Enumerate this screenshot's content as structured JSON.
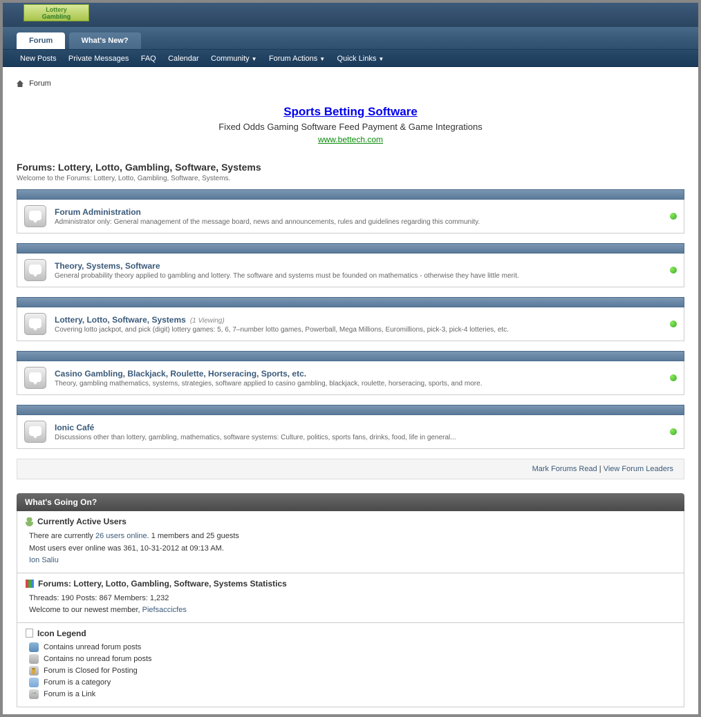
{
  "logo": {
    "line1": "Lottery",
    "line2": "Gambling"
  },
  "tabs": [
    {
      "label": "Forum",
      "active": true
    },
    {
      "label": "What's New?",
      "active": false
    }
  ],
  "subnav": [
    {
      "label": "New Posts",
      "dropdown": false
    },
    {
      "label": "Private Messages",
      "dropdown": false
    },
    {
      "label": "FAQ",
      "dropdown": false
    },
    {
      "label": "Calendar",
      "dropdown": false
    },
    {
      "label": "Community",
      "dropdown": true
    },
    {
      "label": "Forum Actions",
      "dropdown": true
    },
    {
      "label": "Quick Links",
      "dropdown": true
    }
  ],
  "breadcrumb": "Forum",
  "ad": {
    "title": "Sports Betting Software",
    "desc": "Fixed Odds Gaming Software Feed Payment & Game Integrations",
    "url": "www.bettech.com"
  },
  "page": {
    "title": "Forums: Lottery, Lotto, Gambling, Software, Systems",
    "welcome": "Welcome to the Forums: Lottery, Lotto, Gambling, Software, Systems."
  },
  "forums": [
    {
      "title": "Forum Administration",
      "viewing": "",
      "desc": "Administrator only: General management of the message board, news and announcements, rules and guidelines regarding this community."
    },
    {
      "title": "Theory, Systems, Software",
      "viewing": "",
      "desc": "General probability theory applied to gambling and lottery. The software and systems must be founded on mathematics - otherwise they have little merit."
    },
    {
      "title": "Lottery, Lotto, Software, Systems",
      "viewing": "(1 Viewing)",
      "desc": "Covering lotto jackpot, and pick (digit) lottery games: 5, 6, 7–number lotto games, Powerball, Mega Millions, Euromillions, pick-3, pick-4 lotteries, etc."
    },
    {
      "title": "Casino Gambling, Blackjack, Roulette, Horseracing, Sports, etc.",
      "viewing": "",
      "desc": "Theory, gambling mathematics, systems, strategies, software applied to casino gambling, blackjack, roulette, horseracing, sports, and more."
    },
    {
      "title": "Ionic Café",
      "viewing": "",
      "desc": "Discussions other than lottery, gambling, mathematics, software systems: Culture, politics, sports fans, drinks, food, life in general..."
    }
  ],
  "footerlinks": {
    "read": "Mark Forums Read",
    "sep": " | ",
    "leaders": "View Forum Leaders"
  },
  "wgo": {
    "header": "What's Going On?",
    "users": {
      "title": "Currently Active Users",
      "line1a": "There are currently ",
      "line1b": "26 users online",
      "line1c": ". 1 members and 25 guests",
      "line2": "Most users ever online was 361, 10-31-2012 at 09:13 AM.",
      "member": "Ion Saliu"
    },
    "stats": {
      "title": "Forums: Lottery, Lotto, Gambling, Software, Systems Statistics",
      "line1": "Threads: 190  Posts: 867  Members: 1,232",
      "line2a": "Welcome to our newest member, ",
      "line2b": "Piefsaccicfes"
    },
    "legend": {
      "title": "Icon Legend",
      "items": [
        "Contains unread forum posts",
        "Contains no unread forum posts",
        "Forum is Closed for Posting",
        "Forum is a category",
        "Forum is a Link"
      ]
    }
  }
}
